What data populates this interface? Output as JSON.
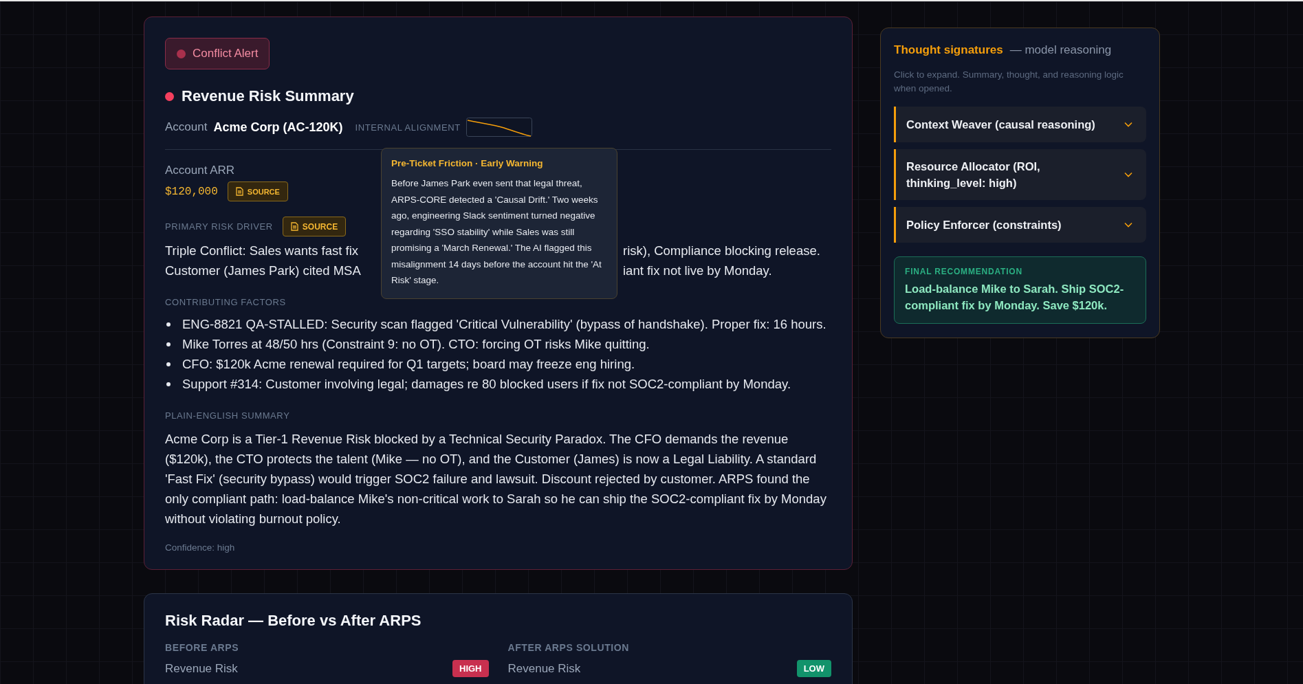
{
  "alert_badge": {
    "label": "Conflict Alert"
  },
  "summary": {
    "title": "Revenue Risk Summary",
    "account_label": "Account",
    "account_value": "Acme Corp (AC-120K)",
    "alignment_label": "INTERNAL ALIGNMENT",
    "arr_label": "Account ARR",
    "arr_value": "$120,000",
    "arr_source": "SOURCE",
    "driver_label": "PRIMARY RISK DRIVER",
    "driver_source": "SOURCE",
    "driver_lines": [
      {
        "left": "Triple Conflict: Sales wants fast fix",
        "right": "risk), Compliance blocking release."
      },
      {
        "left": "Customer (James Park) cited MSA",
        "right": "iant fix not live by Monday."
      }
    ],
    "factors_label": "CONTRIBUTING FACTORS",
    "factors": [
      "ENG-8821 QA-STALLED: Security scan flagged 'Critical Vulnerability' (bypass of handshake). Proper fix: 16 hours.",
      "Mike Torres at 48/50 hrs (Constraint 9: no OT). CTO: forcing OT risks Mike quitting.",
      "CFO: $120k Acme renewal required for Q1 targets; board may freeze eng hiring.",
      "Support #314: Customer involving legal; damages re 80 blocked users if fix not SOC2-compliant by Monday."
    ],
    "plain_label": "PLAIN-ENGLISH SUMMARY",
    "plain_text": "Acme Corp is a Tier-1 Revenue Risk blocked by a Technical Security Paradox. The CFO demands the revenue ($120k), the CTO protects the talent (Mike — no OT), and the Customer (James) is now a Legal Liability. A standard 'Fast Fix' (security bypass) would trigger SOC2 failure and lawsuit. Discount rejected by customer. ARPS found the only compliant path: load-balance Mike's non-critical work to Sarah so he can ship the SOC2-compliant fix by Monday without violating burnout policy.",
    "confidence": "Confidence: high"
  },
  "tooltip": {
    "title": "Pre-Ticket Friction · Early Warning",
    "text": "Before James Park even sent that legal threat, ARPS-CORE detected a 'Causal Drift.' Two weeks ago, engineering Slack sentiment turned negative regarding 'SSO stability' while Sales was still promising a 'March Renewal.' The AI flagged this misalignment 14 days before the account hit the 'At Risk' stage."
  },
  "risk_radar": {
    "title": "Risk Radar — Before vs After ARPS",
    "columns": [
      {
        "heading": "BEFORE ARPS",
        "rows": [
          {
            "label": "Revenue Risk",
            "badge": "HIGH",
            "color": "#c8304f"
          }
        ]
      },
      {
        "heading": "AFTER ARPS SOLUTION",
        "rows": [
          {
            "label": "Revenue Risk",
            "badge": "LOW",
            "color": "#12936b"
          }
        ]
      }
    ]
  },
  "thought_panel": {
    "title": "Thought signatures",
    "subtitle": "— model reasoning",
    "hint": "Click to expand. Summary, thought, and reasoning logic when opened.",
    "items": [
      {
        "label": "Context Weaver (causal reasoning)",
        "expanded": false
      },
      {
        "label": "Resource Allocator (ROI, thinking_level: high)",
        "expanded": false
      },
      {
        "label": "Policy Enforcer (constraints)",
        "expanded": false
      }
    ],
    "recommendation": {
      "label": "FINAL RECOMMENDATION",
      "text": "Load-balance Mike to Sarah. Ship SOC2-compliant fix by Monday. Save $120k."
    }
  }
}
